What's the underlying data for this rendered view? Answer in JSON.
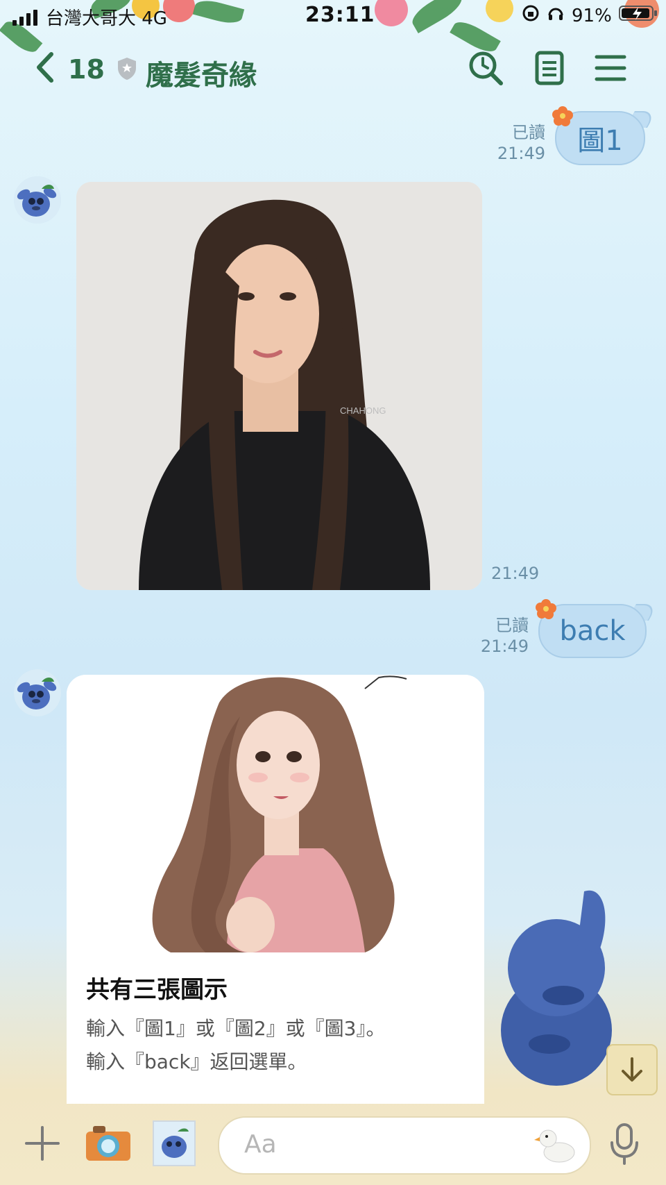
{
  "status_bar": {
    "carrier": "台灣大哥大  4G",
    "time": "23:11",
    "battery": "91%"
  },
  "header": {
    "back_count": "18",
    "chat_title": "魔髮奇緣",
    "icons": [
      "search-icon",
      "notes-icon",
      "menu-icon"
    ]
  },
  "messages": [
    {
      "type": "outgoing",
      "read": "已讀",
      "time": "21:49",
      "text": "圖1"
    },
    {
      "type": "incoming-image",
      "time": "21:49",
      "watermark": "CHAHONG"
    },
    {
      "type": "outgoing",
      "read": "已讀",
      "time": "21:49",
      "text": "back"
    },
    {
      "type": "incoming-card",
      "title": "共有三張圖示",
      "body": "輸入『圖1』或『圖2』或『圖3』。\n輸入『back』返回選單。"
    }
  ],
  "input": {
    "placeholder": "Aa"
  },
  "colors": {
    "header_green": "#2f6f4a",
    "bubble_blue": "#c0def3",
    "bubble_text": "#3d7db1"
  }
}
